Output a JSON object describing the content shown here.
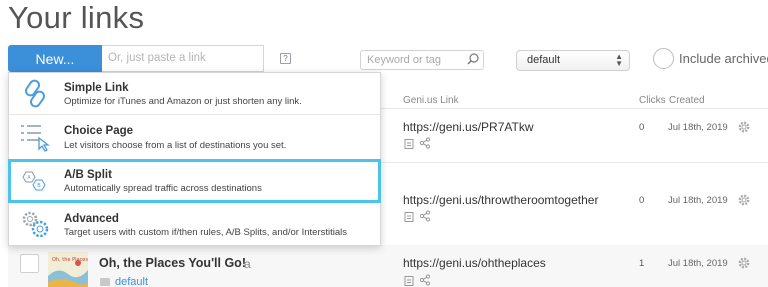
{
  "page": {
    "title": "Your links"
  },
  "toolbar": {
    "new_label": "New...",
    "paste_placeholder": "Or, just paste a link",
    "help_glyph": "?",
    "search_placeholder": "Keyword or tag",
    "filter_value": "default",
    "archived_label": "Include archived"
  },
  "table": {
    "headers": {
      "link": "Geni.us Link",
      "clicks": "Clicks",
      "created": "Created"
    },
    "rows": [
      {
        "url": "https://geni.us/PR7ATkw",
        "clicks": "0",
        "created": "Jul 18th, 2019"
      },
      {
        "url": "https://geni.us/throwtheroomtogether",
        "clicks": "0",
        "created": "Jul 18th, 2019"
      },
      {
        "title": "Oh, the Places You'll Go!",
        "folder": "default",
        "url": "https://geni.us/ohtheplaces",
        "clicks": "1",
        "created": "Jul 18th, 2019"
      }
    ]
  },
  "new_menu": {
    "items": [
      {
        "title": "Simple Link",
        "desc": "Optimize for iTunes and Amazon or just shorten any link.",
        "icon": "link-chain-icon"
      },
      {
        "title": "Choice Page",
        "desc": "Let visitors choose from a list of destinations you set.",
        "icon": "choice-list-icon"
      },
      {
        "title": "A/B Split",
        "desc": "Automatically spread traffic across destinations",
        "icon": "ab-split-icon",
        "icon_letters": [
          "A",
          "B"
        ]
      },
      {
        "title": "Advanced",
        "desc": "Target users with custom if/then rules, A/B Splits, and/or Interstitials",
        "icon": "gears-icon"
      }
    ]
  },
  "colors": {
    "accent": "#3c8fd9",
    "highlight": "#4cc4ea"
  }
}
